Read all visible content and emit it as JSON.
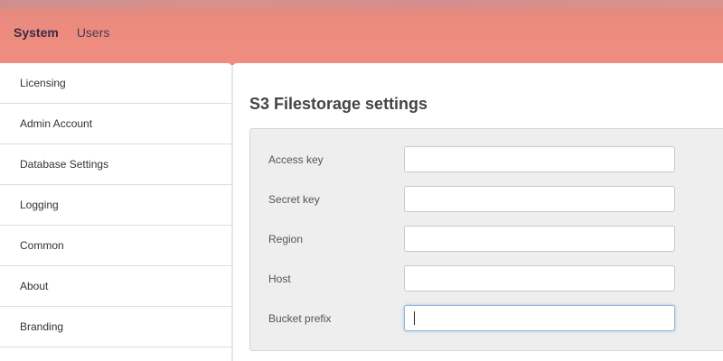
{
  "nav": {
    "items": [
      {
        "label": "System",
        "active": true
      },
      {
        "label": "Users",
        "active": false
      }
    ]
  },
  "sidebar": {
    "items": [
      {
        "label": "Licensing"
      },
      {
        "label": "Admin Account"
      },
      {
        "label": "Database Settings"
      },
      {
        "label": "Logging"
      },
      {
        "label": "Common"
      },
      {
        "label": "About"
      },
      {
        "label": "Branding"
      }
    ]
  },
  "main": {
    "title": "S3 Filestorage settings",
    "form": {
      "fields": [
        {
          "label": "Access key",
          "value": "",
          "focused": false
        },
        {
          "label": "Secret key",
          "value": "",
          "focused": false
        },
        {
          "label": "Region",
          "value": "",
          "focused": false
        },
        {
          "label": "Host",
          "value": "",
          "focused": false
        },
        {
          "label": "Bucket prefix",
          "value": "",
          "focused": true
        }
      ]
    }
  },
  "colors": {
    "topbar": "#ec8b7e",
    "nav_text": "#4a3a55",
    "focus_border": "#8fb5d9"
  }
}
